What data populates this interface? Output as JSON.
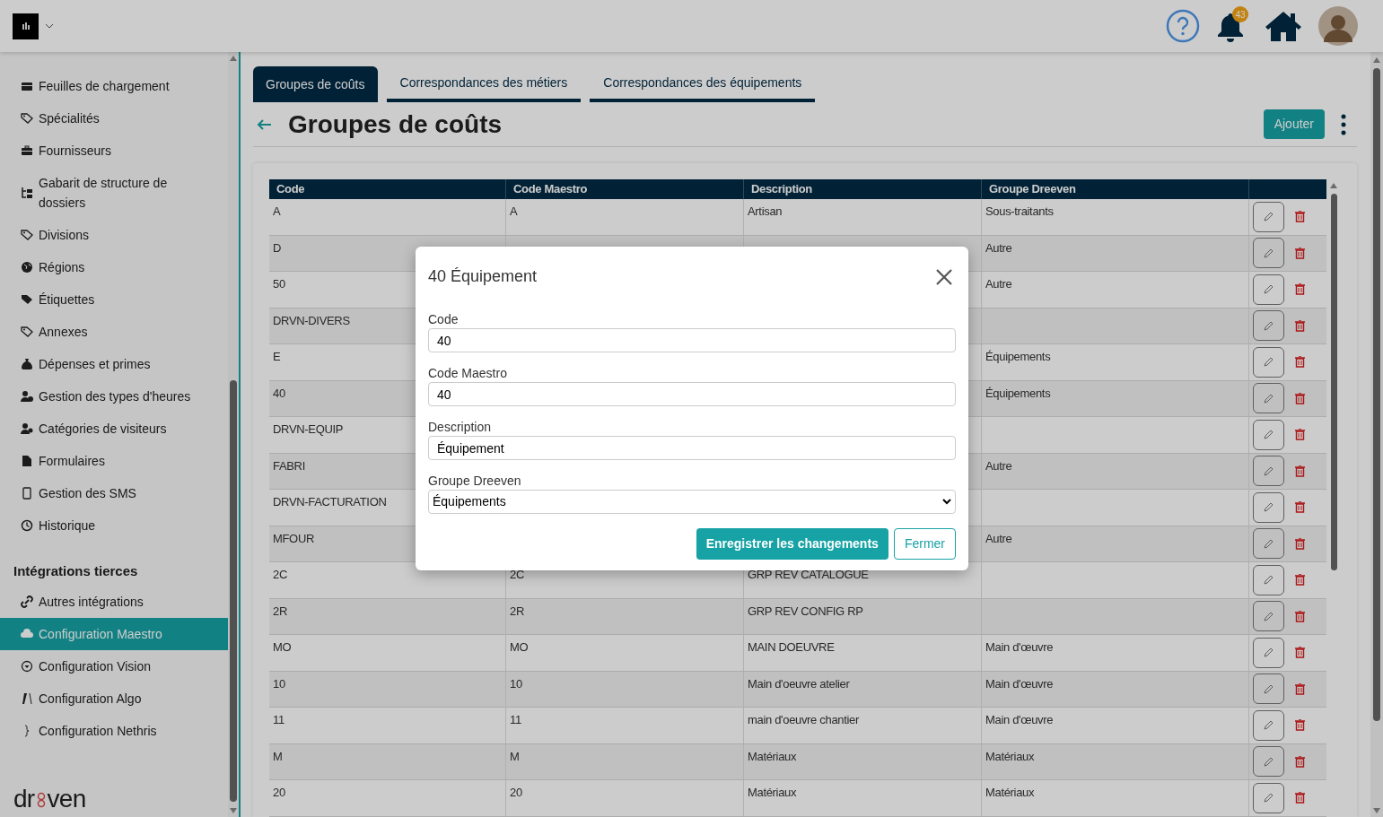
{
  "header": {
    "notification_count": "43"
  },
  "sidebar": {
    "items": [
      {
        "label": "Feuilles de chargement",
        "selected": false
      },
      {
        "label": "Spécialités",
        "selected": false
      },
      {
        "label": "Fournisseurs",
        "selected": false
      },
      {
        "label": "Gabarit de structure de dossiers",
        "selected": false
      },
      {
        "label": "Divisions",
        "selected": false
      },
      {
        "label": "Régions",
        "selected": false
      },
      {
        "label": "Étiquettes",
        "selected": false
      },
      {
        "label": "Annexes",
        "selected": false
      },
      {
        "label": "Dépenses et primes",
        "selected": false
      },
      {
        "label": "Gestion des types d'heures",
        "selected": false
      },
      {
        "label": "Catégories de visiteurs",
        "selected": false
      },
      {
        "label": "Formulaires",
        "selected": false
      },
      {
        "label": "Gestion des SMS",
        "selected": false
      },
      {
        "label": "Historique",
        "selected": false
      }
    ],
    "section_title": "Intégrations tierces",
    "section_items": [
      {
        "label": "Autres intégrations",
        "selected": false
      },
      {
        "label": "Configuration Maestro",
        "selected": true
      },
      {
        "label": "Configuration Vision",
        "selected": false
      },
      {
        "label": "Configuration Algo",
        "selected": false
      },
      {
        "label": "Configuration Nethris",
        "selected": false
      }
    ],
    "brand": {
      "left": "dr",
      "right": "ven"
    }
  },
  "tabs": [
    {
      "label": "Groupes de coûts",
      "selected": true
    },
    {
      "label": "Correspondances des métiers",
      "selected": false
    },
    {
      "label": "Correspondances des équipements",
      "selected": false
    }
  ],
  "page_title": "Groupes de coûts",
  "add_button": "Ajouter",
  "table": {
    "columns": [
      "Code",
      "Code Maestro",
      "Description",
      "Groupe Dreeven"
    ],
    "rows": [
      {
        "code": "A",
        "maestro": "A",
        "description": "Artisan",
        "group": "Sous-traitants"
      },
      {
        "code": "D",
        "group": "Autre"
      },
      {
        "code": "50",
        "group": "Autre"
      },
      {
        "code": "DRVN-DIVERS"
      },
      {
        "code": "E",
        "group": "Équipements"
      },
      {
        "code": "40",
        "group": "Équipements"
      },
      {
        "code": "DRVN-EQUIP"
      },
      {
        "code": "FABRI",
        "group": "Autre"
      },
      {
        "code": "DRVN-FACTURATION"
      },
      {
        "code": "MFOUR",
        "group": "Autre"
      },
      {
        "code": "2C",
        "maestro": "2C",
        "description": "GRP REV CATALOGUE"
      },
      {
        "code": "2R",
        "maestro": "2R",
        "description": "GRP REV CONFIG RP"
      },
      {
        "code": "MO",
        "maestro": "MO",
        "description": "MAIN DOEUVRE",
        "group": "Main d'œuvre"
      },
      {
        "code": "10",
        "maestro": "10",
        "description": "Main d'oeuvre atelier",
        "group": "Main d'œuvre"
      },
      {
        "code": "11",
        "maestro": "11",
        "description": "main d'oeuvre chantier",
        "group": "Main d'œuvre"
      },
      {
        "code": "M",
        "maestro": "M",
        "description": "Matériaux",
        "group": "Matériaux"
      },
      {
        "code": "20",
        "maestro": "20",
        "description": "Matériaux",
        "group": "Matériaux"
      }
    ]
  },
  "modal": {
    "title": "40 Équipement",
    "fields": [
      {
        "label": "Code",
        "value": "40",
        "kind": "text"
      },
      {
        "label": "Code Maestro",
        "value": "40",
        "kind": "text"
      },
      {
        "label": "Description",
        "value": "Équipement",
        "kind": "text"
      },
      {
        "label": "Groupe Dreeven",
        "value": "Équipements",
        "kind": "select"
      }
    ],
    "save_button": "Enregistrer les changements",
    "close_button": "Fermer"
  }
}
